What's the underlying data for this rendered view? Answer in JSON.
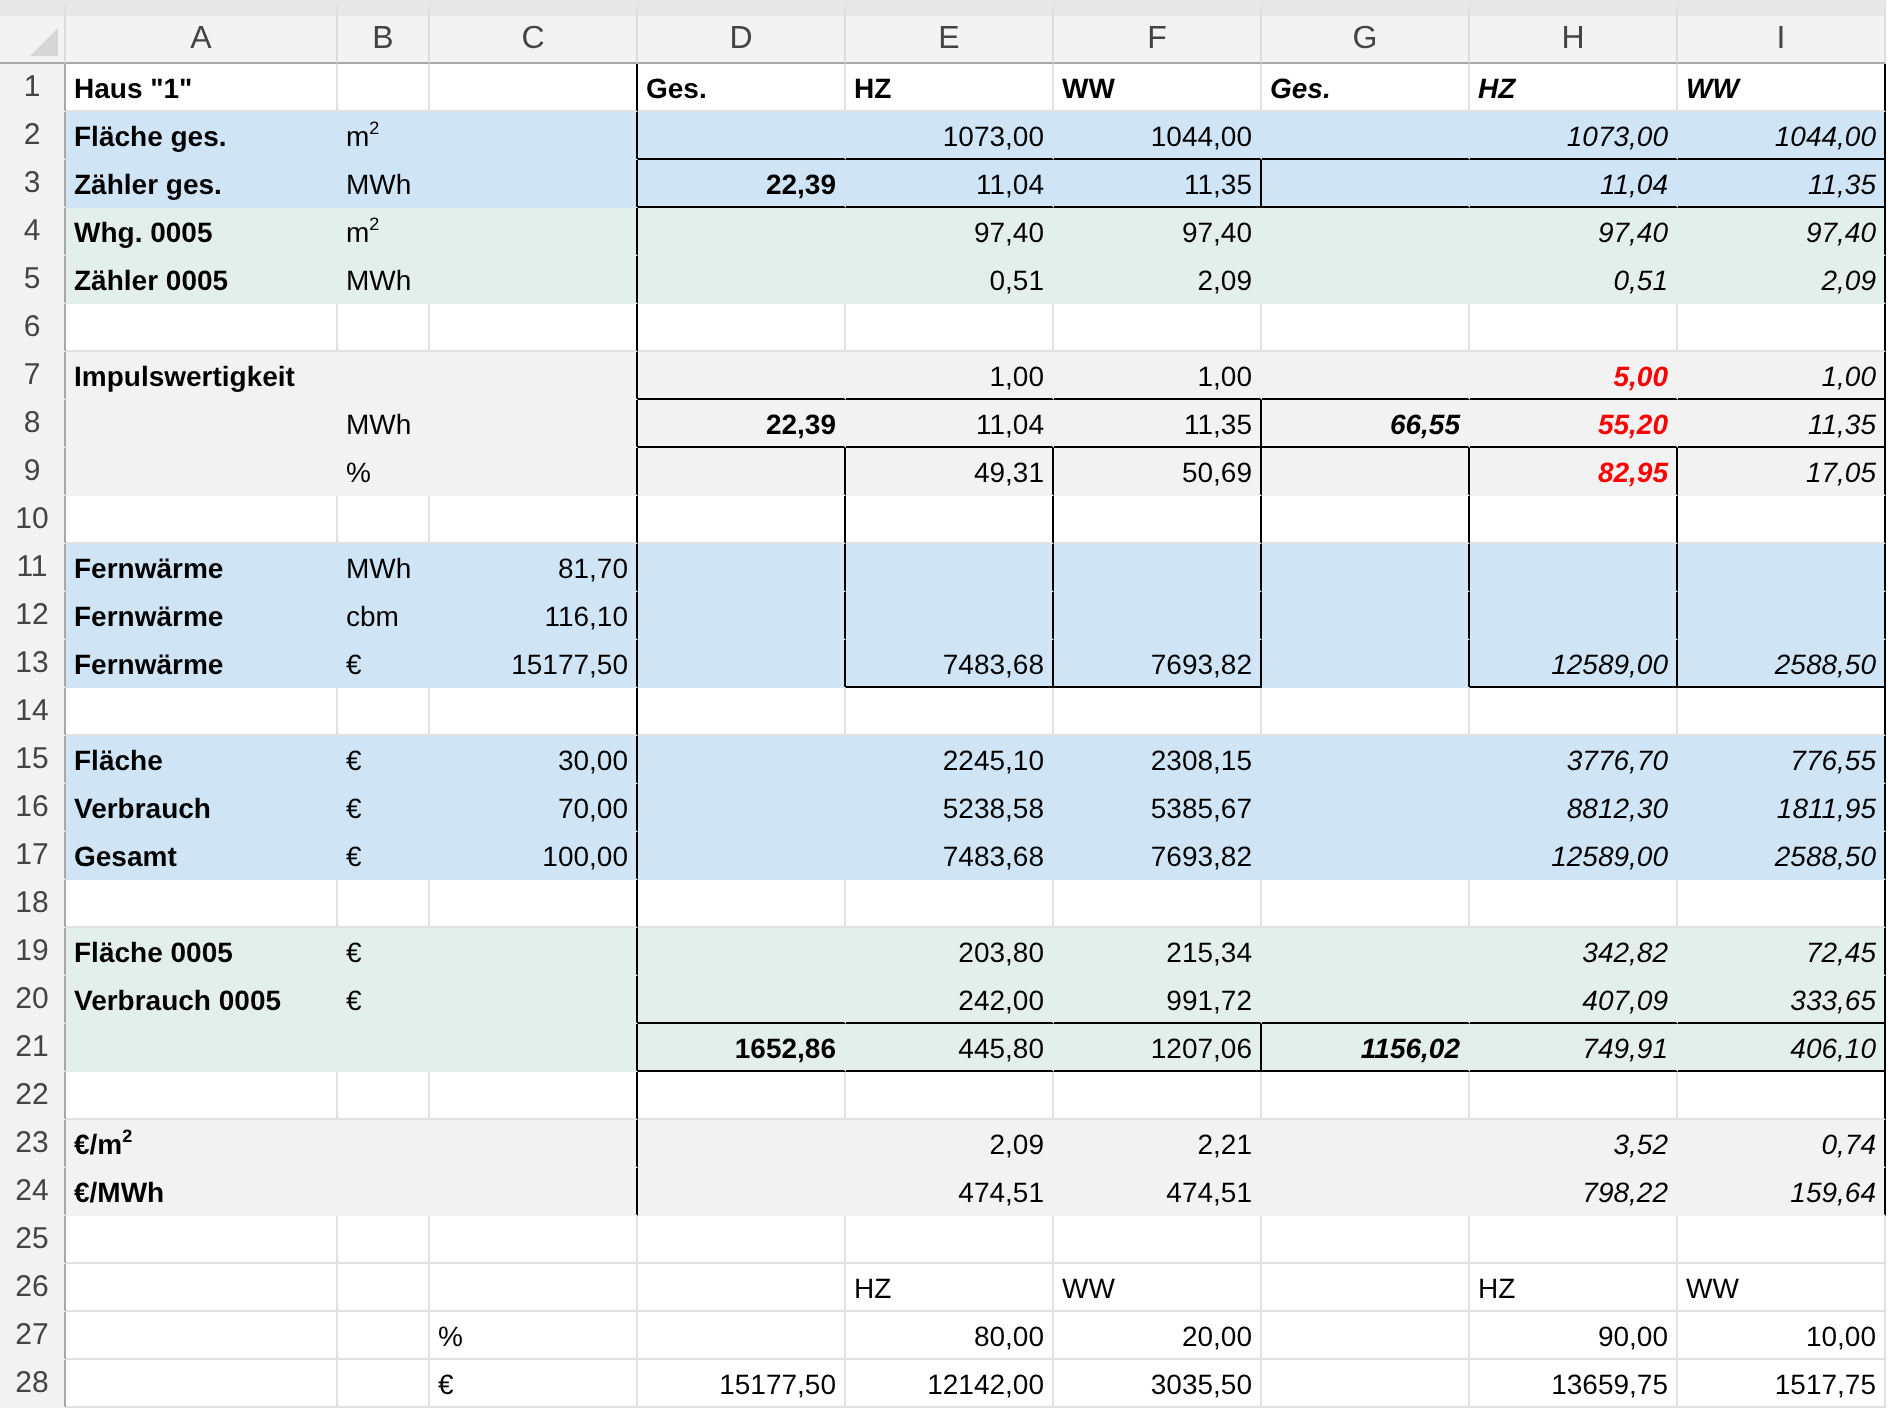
{
  "sheet": {
    "columns": [
      "A",
      "B",
      "C",
      "D",
      "E",
      "F",
      "G",
      "H",
      "I"
    ],
    "rows": [
      {
        "number": "1",
        "cells": [
          {
            "text": "Haus \"1\"",
            "kind": "text",
            "bold": true,
            "italic": false
          },
          "",
          "",
          {
            "text": "Ges.",
            "kind": "text",
            "bold": true,
            "italic": false
          },
          {
            "text": "HZ",
            "kind": "text",
            "bold": true,
            "italic": false
          },
          {
            "text": "WW",
            "kind": "text",
            "bold": true,
            "italic": false
          },
          {
            "text": "Ges.",
            "kind": "text",
            "bold": true,
            "italic": true
          },
          {
            "text": "HZ",
            "kind": "text",
            "bold": true,
            "italic": true
          },
          {
            "text": "WW",
            "kind": "text",
            "bold": true,
            "italic": true
          }
        ]
      },
      {
        "number": "2",
        "color": "#cfe4f5",
        "cells": [
          {
            "text": "Fläche ges.",
            "kind": "text",
            "bold": true,
            "italic": false
          },
          {
            "text": "m$^{2}$",
            "kind": "text",
            "bold": false,
            "italic": false
          },
          "",
          "",
          {
            "text": "1073,00",
            "kind": "number",
            "bold": false,
            "italic": false
          },
          {
            "text": "1044,00",
            "kind": "number",
            "bold": false,
            "italic": false
          },
          "",
          {
            "text": "1073,00",
            "kind": "number",
            "bold": false,
            "italic": true
          },
          {
            "text": "1044,00",
            "kind": "number",
            "bold": false,
            "italic": true
          }
        ]
      },
      {
        "number": "3",
        "color": "#cfe4f5",
        "cells": [
          {
            "text": "Zähler ges.",
            "kind": "text",
            "bold": true,
            "italic": false
          },
          {
            "text": "MWh",
            "kind": "text",
            "bold": false,
            "italic": false
          },
          "",
          {
            "text": "22,39",
            "kind": "number",
            "bold": true,
            "italic": false
          },
          {
            "text": "11,04",
            "kind": "number",
            "bold": false,
            "italic": false
          },
          {
            "text": "11,35",
            "kind": "number",
            "bold": false,
            "italic": false
          },
          "",
          {
            "text": "11,04",
            "kind": "number",
            "bold": false,
            "italic": true
          },
          {
            "text": "11,35",
            "kind": "number",
            "bold": false,
            "italic": true
          }
        ]
      },
      {
        "number": "4",
        "color": "#e2efeb",
        "cells": [
          {
            "text": "Whg. 0005",
            "kind": "text",
            "bold": true,
            "italic": false
          },
          {
            "text": "m$^{2}$",
            "kind": "text",
            "bold": false,
            "italic": false
          },
          "",
          "",
          {
            "text": "97,40",
            "kind": "number",
            "bold": false,
            "italic": false
          },
          {
            "text": "97,40",
            "kind": "number",
            "bold": false,
            "italic": false
          },
          "",
          {
            "text": "97,40",
            "kind": "number",
            "bold": false,
            "italic": true
          },
          {
            "text": "97,40",
            "kind": "number",
            "bold": false,
            "italic": true
          }
        ]
      },
      {
        "number": "5",
        "color": "#e2efeb",
        "cells": [
          {
            "text": "Zähler 0005",
            "kind": "text",
            "bold": true,
            "italic": false
          },
          {
            "text": "MWh",
            "kind": "text",
            "bold": false,
            "italic": false
          },
          "",
          "",
          {
            "text": "0,51",
            "kind": "number",
            "bold": false,
            "italic": false
          },
          {
            "text": "2,09",
            "kind": "number",
            "bold": false,
            "italic": false
          },
          "",
          {
            "text": "0,51",
            "kind": "number",
            "bold": false,
            "italic": true
          },
          {
            "text": "2,09",
            "kind": "number",
            "bold": false,
            "italic": true
          }
        ]
      },
      {
        "number": "6",
        "cells": []
      },
      {
        "number": "7",
        "color": "#f2f2f2",
        "cells": [
          {
            "text": "Impulswertigkeit",
            "kind": "text",
            "bold": true,
            "italic": false
          },
          "",
          "",
          "",
          {
            "text": "1,00",
            "kind": "number",
            "bold": false,
            "italic": false
          },
          {
            "text": "1,00",
            "kind": "number",
            "bold": false,
            "italic": false
          },
          "",
          {
            "text": "5,00",
            "kind": "number",
            "bold": true,
            "italic": true,
            "color": "#ff0000"
          },
          {
            "text": "1,00",
            "kind": "number",
            "bold": false,
            "italic": true
          }
        ]
      },
      {
        "number": "8",
        "color": "#f2f2f2",
        "cells": [
          "",
          {
            "text": "MWh",
            "kind": "text",
            "bold": false,
            "italic": false
          },
          "",
          {
            "text": "22,39",
            "kind": "number",
            "bold": true,
            "italic": false
          },
          {
            "text": "11,04",
            "kind": "number",
            "bold": false,
            "italic": false
          },
          {
            "text": "11,35",
            "kind": "number",
            "bold": false,
            "italic": false
          },
          {
            "text": "66,55",
            "kind": "number",
            "bold": true,
            "italic": true
          },
          {
            "text": "55,20",
            "kind": "number",
            "bold": true,
            "italic": true,
            "color": "#ff0000"
          },
          {
            "text": "11,35",
            "kind": "number",
            "bold": false,
            "italic": true
          }
        ]
      },
      {
        "number": "9",
        "color": "#f2f2f2",
        "cells": [
          "",
          {
            "text": "%",
            "kind": "text",
            "bold": false,
            "italic": false
          },
          "",
          "",
          {
            "text": "49,31",
            "kind": "number",
            "bold": false,
            "italic": false
          },
          {
            "text": "50,69",
            "kind": "number",
            "bold": false,
            "italic": false
          },
          "",
          {
            "text": "82,95",
            "kind": "number",
            "bold": true,
            "italic": true,
            "color": "#ff0000"
          },
          {
            "text": "17,05",
            "kind": "number",
            "bold": false,
            "italic": true
          }
        ]
      },
      {
        "number": "10",
        "cells": []
      },
      {
        "number": "11",
        "color": "#cfe4f5",
        "cells": [
          {
            "text": "Fernwärme",
            "kind": "text",
            "bold": true,
            "italic": false
          },
          {
            "text": "MWh",
            "kind": "text",
            "bold": false,
            "italic": false
          },
          {
            "text": "81,70",
            "kind": "number",
            "bold": false,
            "italic": false
          }
        ]
      },
      {
        "number": "12",
        "color": "#cfe4f5",
        "cells": [
          {
            "text": "Fernwärme",
            "kind": "text",
            "bold": true,
            "italic": false
          },
          {
            "text": "cbm",
            "kind": "text",
            "bold": false,
            "italic": false
          },
          {
            "text": "116,10",
            "kind": "number",
            "bold": false,
            "italic": false
          }
        ]
      },
      {
        "number": "13",
        "color": "#cfe4f5",
        "cells": [
          {
            "text": "Fernwärme",
            "kind": "text",
            "bold": true,
            "italic": false
          },
          {
            "text": "€",
            "kind": "text",
            "bold": false,
            "italic": false
          },
          {
            "text": "15177,50",
            "kind": "number",
            "bold": false,
            "italic": false
          },
          "",
          {
            "text": "7483,68",
            "kind": "number",
            "bold": false,
            "italic": false
          },
          {
            "text": "7693,82",
            "kind": "number",
            "bold": false,
            "italic": false
          },
          "",
          {
            "text": "12589,00",
            "kind": "number",
            "bold": false,
            "italic": true
          },
          {
            "text": "2588,50",
            "kind": "number",
            "bold": false,
            "italic": true
          }
        ]
      },
      {
        "number": "14",
        "cells": []
      },
      {
        "number": "15",
        "color": "#cfe4f5",
        "cells": [
          {
            "text": "Fläche",
            "kind": "text",
            "bold": true,
            "italic": false
          },
          {
            "text": "€",
            "kind": "text",
            "bold": false,
            "italic": false
          },
          {
            "text": "30,00",
            "kind": "number",
            "bold": false,
            "italic": false
          },
          "",
          {
            "text": "2245,10",
            "kind": "number",
            "bold": false,
            "italic": false
          },
          {
            "text": "2308,15",
            "kind": "number",
            "bold": false,
            "italic": false
          },
          "",
          {
            "text": "3776,70",
            "kind": "number",
            "bold": false,
            "italic": true
          },
          {
            "text": "776,55",
            "kind": "number",
            "bold": false,
            "italic": true
          }
        ]
      },
      {
        "number": "16",
        "color": "#cfe4f5",
        "cells": [
          {
            "text": "Verbrauch",
            "kind": "text",
            "bold": true,
            "italic": false
          },
          {
            "text": "€",
            "kind": "text",
            "bold": false,
            "italic": false
          },
          {
            "text": "70,00",
            "kind": "number",
            "bold": false,
            "italic": false
          },
          "",
          {
            "text": "5238,58",
            "kind": "number",
            "bold": false,
            "italic": false
          },
          {
            "text": "5385,67",
            "kind": "number",
            "bold": false,
            "italic": false
          },
          "",
          {
            "text": "8812,30",
            "kind": "number",
            "bold": false,
            "italic": true
          },
          {
            "text": "1811,95",
            "kind": "number",
            "bold": false,
            "italic": true
          }
        ]
      },
      {
        "number": "17",
        "color": "#cfe4f5",
        "cells": [
          {
            "text": "Gesamt",
            "kind": "text",
            "bold": true,
            "italic": false
          },
          {
            "text": "€",
            "kind": "text",
            "bold": false,
            "italic": false
          },
          {
            "text": "100,00",
            "kind": "number",
            "bold": false,
            "italic": false
          },
          "",
          {
            "text": "7483,68",
            "kind": "number",
            "bold": false,
            "italic": false
          },
          {
            "text": "7693,82",
            "kind": "number",
            "bold": false,
            "italic": false
          },
          "",
          {
            "text": "12589,00",
            "kind": "number",
            "bold": false,
            "italic": true
          },
          {
            "text": "2588,50",
            "kind": "number",
            "bold": false,
            "italic": true
          }
        ]
      },
      {
        "number": "18",
        "cells": []
      },
      {
        "number": "19",
        "color": "#e2efeb",
        "cells": [
          {
            "text": "Fläche 0005",
            "kind": "text",
            "bold": true,
            "italic": false
          },
          {
            "text": "€",
            "kind": "text",
            "bold": false,
            "italic": false
          },
          "",
          "",
          {
            "text": "203,80",
            "kind": "number",
            "bold": false,
            "italic": false
          },
          {
            "text": "215,34",
            "kind": "number",
            "bold": false,
            "italic": false
          },
          "",
          {
            "text": "342,82",
            "kind": "number",
            "bold": false,
            "italic": true
          },
          {
            "text": "72,45",
            "kind": "number",
            "bold": false,
            "italic": true
          }
        ]
      },
      {
        "number": "20",
        "color": "#e2efeb",
        "cells": [
          {
            "text": "Verbrauch 0005",
            "kind": "text",
            "bold": true,
            "italic": false
          },
          {
            "text": "€",
            "kind": "text",
            "bold": false,
            "italic": false
          },
          "",
          "",
          {
            "text": "242,00",
            "kind": "number",
            "bold": false,
            "italic": false
          },
          {
            "text": "991,72",
            "kind": "number",
            "bold": false,
            "italic": false
          },
          "",
          {
            "text": "407,09",
            "kind": "number",
            "bold": false,
            "italic": true
          },
          {
            "text": "333,65",
            "kind": "number",
            "bold": false,
            "italic": true
          }
        ]
      },
      {
        "number": "21",
        "color": "#e2efeb",
        "cells": [
          "",
          "",
          "",
          {
            "text": "1652,86",
            "kind": "number",
            "bold": true,
            "italic": false
          },
          {
            "text": "445,80",
            "kind": "number",
            "bold": false,
            "italic": false
          },
          {
            "text": "1207,06",
            "kind": "number",
            "bold": false,
            "italic": false
          },
          {
            "text": "1156,02",
            "kind": "number",
            "bold": true,
            "italic": true
          },
          {
            "text": "749,91",
            "kind": "number",
            "bold": false,
            "italic": true
          },
          {
            "text": "406,10",
            "kind": "number",
            "bold": false,
            "italic": true
          }
        ]
      },
      {
        "number": "22",
        "cells": []
      },
      {
        "number": "23",
        "color": "#f2f2f2",
        "cells": [
          {
            "text": "€/m$^{2}$",
            "kind": "text",
            "bold": true,
            "italic": false
          },
          "",
          "",
          "",
          {
            "text": "2,09",
            "kind": "number",
            "bold": false,
            "italic": false
          },
          {
            "text": "2,21",
            "kind": "number",
            "bold": false,
            "italic": false
          },
          "",
          {
            "text": "3,52",
            "kind": "number",
            "bold": false,
            "italic": true
          },
          {
            "text": "0,74",
            "kind": "number",
            "bold": false,
            "italic": true
          }
        ]
      },
      {
        "number": "24",
        "color": "#f2f2f2",
        "cells": [
          {
            "text": "€/MWh",
            "kind": "text",
            "bold": true,
            "italic": false
          },
          "",
          "",
          "",
          {
            "text": "474,51",
            "kind": "number",
            "bold": false,
            "italic": false
          },
          {
            "text": "474,51",
            "kind": "number",
            "bold": false,
            "italic": false
          },
          "",
          {
            "text": "798,22",
            "kind": "number",
            "bold": false,
            "italic": true
          },
          {
            "text": "159,64",
            "kind": "number",
            "bold": false,
            "italic": true
          }
        ]
      },
      {
        "number": "25",
        "cells": []
      },
      {
        "number": "26",
        "cells": [
          "",
          "",
          "",
          "",
          {
            "text": "HZ",
            "kind": "text",
            "bold": false,
            "italic": false
          },
          {
            "text": "WW",
            "kind": "text",
            "bold": false,
            "italic": false
          },
          "",
          {
            "text": "HZ",
            "kind": "text",
            "bold": false,
            "italic": false
          },
          {
            "text": "WW",
            "kind": "text",
            "bold": false,
            "italic": false
          }
        ]
      },
      {
        "number": "27",
        "cells": [
          "",
          "",
          {
            "text": "%",
            "kind": "text",
            "bold": false,
            "italic": false
          },
          "",
          {
            "text": "80,00",
            "kind": "number",
            "bold": false,
            "italic": false
          },
          {
            "text": "20,00",
            "kind": "number",
            "bold": false,
            "italic": false
          },
          "",
          {
            "text": "90,00",
            "kind": "number",
            "bold": false,
            "italic": false
          },
          {
            "text": "10,00",
            "kind": "number",
            "bold": false,
            "italic": false
          }
        ]
      },
      {
        "number": "28",
        "cells": [
          "",
          "",
          {
            "text": "€",
            "kind": "text",
            "bold": false,
            "italic": false
          },
          {
            "text": "15177,50",
            "kind": "number",
            "bold": false,
            "italic": false
          },
          {
            "text": "12142,00",
            "kind": "number",
            "bold": false,
            "italic": false
          },
          {
            "text": "3035,50",
            "kind": "number",
            "bold": false,
            "italic": false
          },
          "",
          {
            "text": "13659,75",
            "kind": "number",
            "bold": false,
            "italic": false
          },
          {
            "text": "1517,75",
            "kind": "number",
            "bold": false,
            "italic": false
          }
        ]
      }
    ]
  }
}
